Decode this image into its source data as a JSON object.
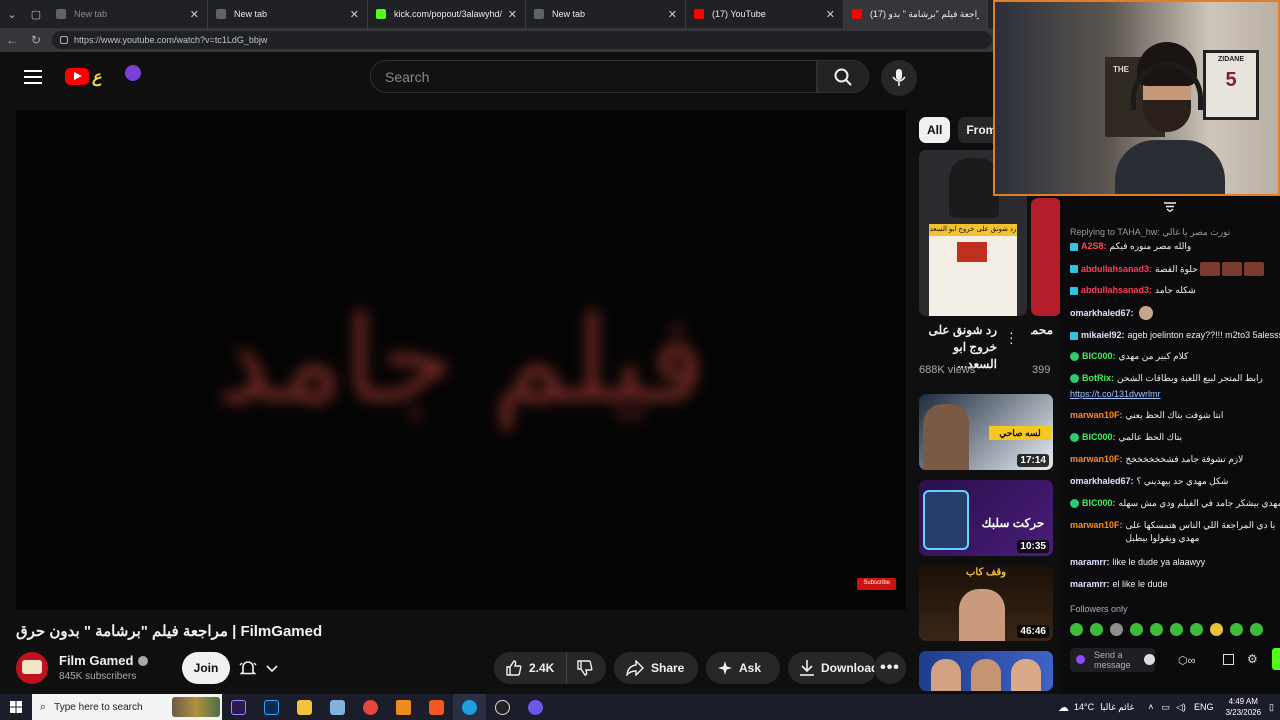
{
  "browser": {
    "tabs": [
      {
        "label": "New tab",
        "dim": true,
        "fav": "#5f6368"
      },
      {
        "label": "New tab",
        "dim": false,
        "fav": "#5f6368"
      },
      {
        "label": "kick.com/popout/3alawyhd/c",
        "dim": false,
        "fav": "#53fc18"
      },
      {
        "label": "New tab",
        "dim": false,
        "fav": "#5f6368"
      },
      {
        "label": "(17) YouTube",
        "dim": false,
        "fav": "#ff0000"
      },
      {
        "label": "(17) مراجعة فيلم \"برشامة \" بدو",
        "dim": false,
        "fav": "#ff0000"
      }
    ],
    "url": "https://www.youtube.com/watch?v=tc1LdG_bbjw"
  },
  "header": {
    "search_placeholder": "Search"
  },
  "player": {
    "calligraphy": "فيلم جامد",
    "subscribe_badge": "Subscribe"
  },
  "video": {
    "title": "مراجعة فيلم \"برشامة \" بدون حرق | FilmGamed",
    "channel": "Film Gamed",
    "subscribers": "845K subscribers",
    "join_label": "Join",
    "likes": "2.4K",
    "share_label": "Share",
    "ask_label": "Ask",
    "download_label": "Download"
  },
  "chips": [
    "All",
    "From"
  ],
  "recommendations": [
    {
      "title": "رد شونق على خروج ابو السعد...",
      "views": "688K views",
      "thumb_text": "رد شونق على خروج ابو السعد",
      "duration": ""
    },
    {
      "title": "محمد بطال",
      "views": "399",
      "duration": ""
    },
    {
      "title": "",
      "views": "",
      "thumb_text": "لسه صاحي",
      "duration": "17:14"
    },
    {
      "title": "",
      "views": "",
      "thumb_text": "حركت سلبك",
      "duration": "10:35"
    },
    {
      "title": "",
      "views": "",
      "thumb_text": "وقف كاب",
      "duration": "46:46"
    },
    {
      "title": "",
      "views": "",
      "duration": ""
    }
  ],
  "chat": {
    "reply_line": "Replying to TAHA_hw: نورت مصر يا غالي",
    "messages": [
      {
        "user": "A2S8:",
        "text": "والله مصر منوره فيكم",
        "color": "#ff4d4d",
        "badge": "blue"
      },
      {
        "user": "abdullahsanad3:",
        "text": "حلوة القصة",
        "color": "#ff3b5c",
        "badge": "blue",
        "emotes": 3
      },
      {
        "user": "abdullahsanad3:",
        "text": "شكله جامد",
        "color": "#ff3b5c",
        "badge": "blue"
      },
      {
        "user": "omarkhaled67:",
        "text": "",
        "color": "#dfe3ff",
        "badge": "none"
      },
      {
        "user": "mikaiel92:",
        "text": "ageb joelinton ezay??!!! m2to3 5alesssss",
        "color": "#dfe3ff",
        "badge": "blue"
      },
      {
        "user": "BIC000:",
        "text": "كلام كبير من مهدي",
        "color": "#3cf05a",
        "badge": "green"
      },
      {
        "user": "BotRix:",
        "text": "رابط المتجر لبيع اللعبة وبطاقات الشحن",
        "color": "#3cf05a",
        "badge": "green",
        "link": "https://t.co/131dvwrlmr"
      },
      {
        "user": "marwan10F:",
        "text": "انتا شوفت بتاك الحظ يعني",
        "color": "#ff8a1c",
        "badge": "none"
      },
      {
        "user": "BIC000:",
        "text": "بتاك الحظ عالمي",
        "color": "#3cf05a",
        "badge": "green"
      },
      {
        "user": "marwan10F:",
        "text": "لازم تشوفة جامد فشخخخخخخخ",
        "color": "#ff8a1c",
        "badge": "none"
      },
      {
        "user": "omarkhaled67:",
        "text": "شكل مهدي حد بيهديني ؟",
        "color": "#dfe3ff",
        "badge": "none"
      },
      {
        "user": "BIC000:",
        "text": "مهدي بيشكر جامد في الفيلم ودي مش سهله",
        "color": "#3cf05a",
        "badge": "green"
      },
      {
        "user": "marwan10F:",
        "text": "يا دي المراجعة اللي الناس هتمسكها على مهدي ويقولوا بيطبل",
        "color": "#ff8a1c",
        "badge": "none"
      },
      {
        "user": "maramrr:",
        "text": "like le dude ya alaawyy",
        "color": "#dfe3ff",
        "badge": "none"
      },
      {
        "user": "maramrr:",
        "text": "el like le dude",
        "color": "#dfe3ff",
        "badge": "none"
      }
    ],
    "followers_only": "Followers only",
    "input_placeholder": "Send a message"
  },
  "webcam": {
    "jersey_name": "ZIDANE",
    "jersey_number": "5",
    "frame_text": "THE"
  },
  "taskbar": {
    "search_placeholder": "Type here to search",
    "weather": "14°C",
    "weather_label": "غائم غالبا",
    "language": "ENG",
    "time": "4:49 AM",
    "date": "3/23/2026"
  }
}
